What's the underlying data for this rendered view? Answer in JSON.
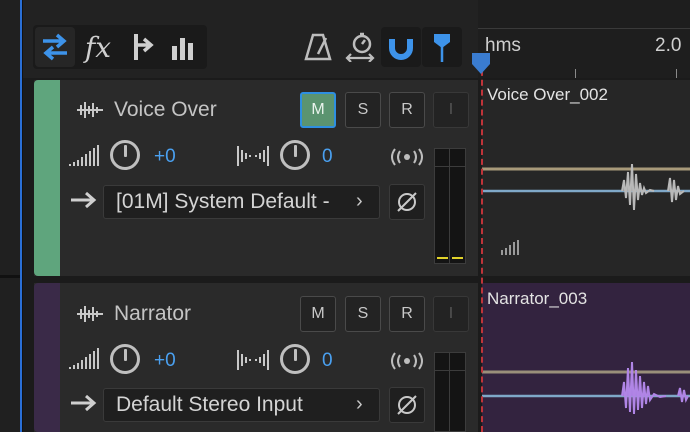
{
  "toolbar": {
    "buttons": [
      {
        "name": "swap-tracks",
        "active": true
      },
      {
        "name": "fx",
        "label": "fx"
      },
      {
        "name": "sends"
      },
      {
        "name": "eq"
      }
    ]
  },
  "timeline": {
    "units_label": "hms",
    "time_label": "2.0"
  },
  "tracks": [
    {
      "name": "Voice Over",
      "color": "#5fa57d",
      "m_label": "M",
      "s_label": "S",
      "r_label": "R",
      "i_label": "I",
      "volume": "+0",
      "pan": "0",
      "input": "[01M] System Default -",
      "clip_name": "Voice Over_002"
    },
    {
      "name": "Narrator",
      "color": "#3a2a48",
      "m_label": "M",
      "s_label": "S",
      "r_label": "R",
      "i_label": "I",
      "volume": "+0",
      "pan": "0",
      "input": "Default Stereo Input",
      "clip_name": "Narrator_003"
    }
  ],
  "colors": {
    "accent": "#2e8fe0",
    "mute_on": "#5b9470",
    "narrator_clip": "#33233f",
    "waveform_narrator": "#b085e6",
    "waveform_voice": "#b9b9b9",
    "playhead": "#c0343a"
  }
}
